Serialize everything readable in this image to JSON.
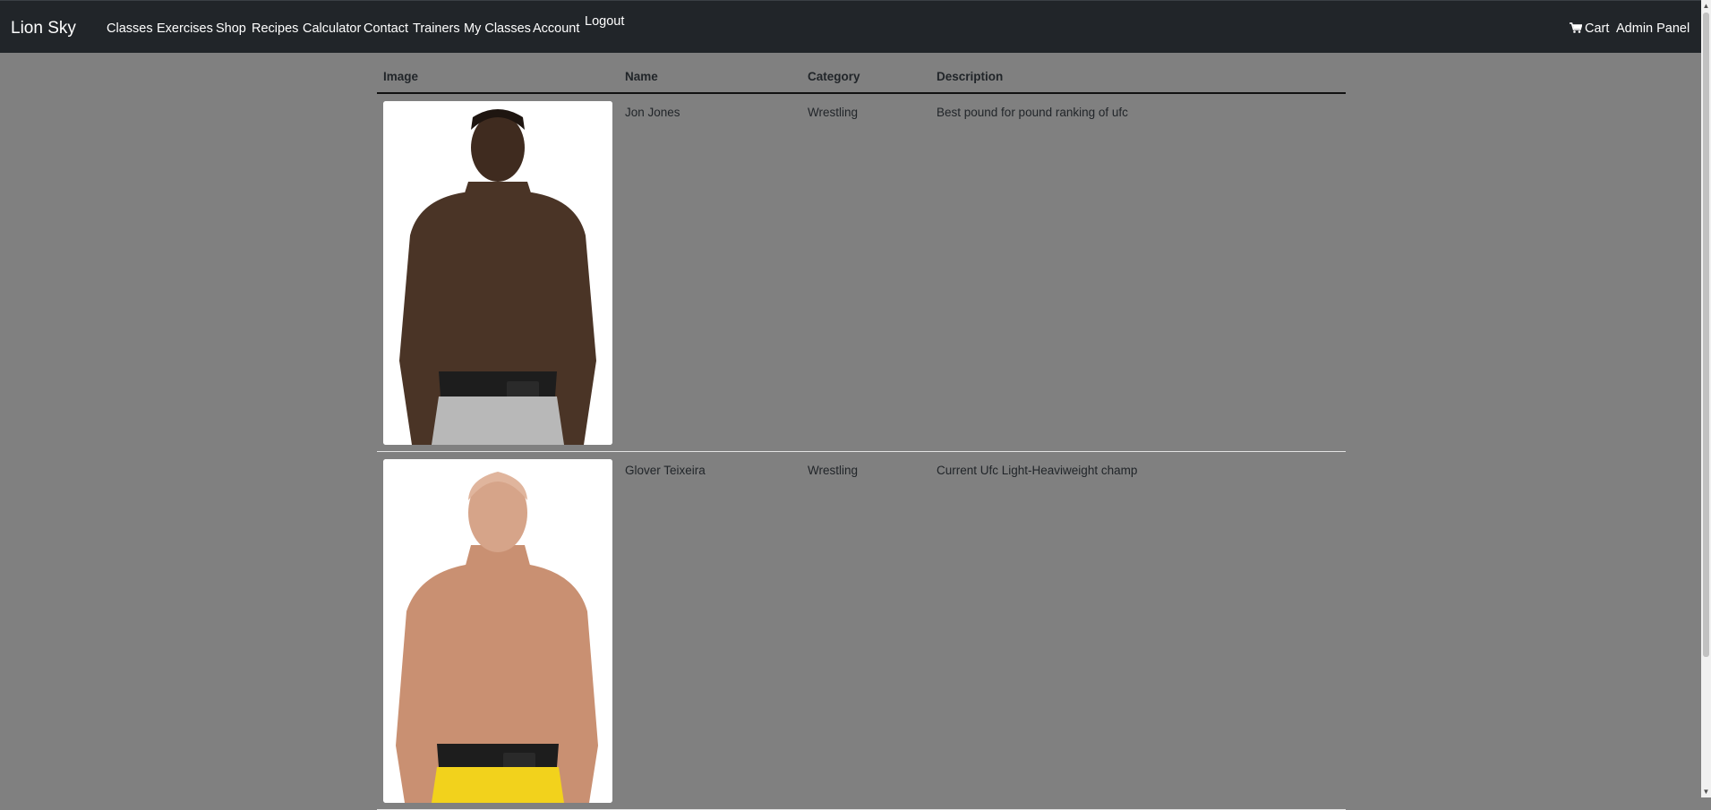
{
  "navbar": {
    "brand": "Lion Sky",
    "links": [
      "Classes",
      "Exercises",
      "Shop",
      "Recipes",
      "Calculator",
      "Contact",
      "Trainers",
      "My Classes",
      "Account"
    ],
    "logout": "Logout",
    "cart": "Cart",
    "admin": "Admin Panel"
  },
  "table": {
    "headers": [
      "Image",
      "Name",
      "Category",
      "Description"
    ],
    "rows": [
      {
        "name": "Jon Jones",
        "category": "Wrestling",
        "description": "Best pound for pound ranking of ufc",
        "shorts_color": "#b8b8b8"
      },
      {
        "name": "Glover Teixeira",
        "category": "Wrestling",
        "description": "Current Ufc Light-Heaviweight champ",
        "shorts_color": "#f2d21c"
      }
    ]
  },
  "colors": {
    "navbar_bg": "#212529",
    "page_bg": "#808080",
    "text": "#212529"
  }
}
